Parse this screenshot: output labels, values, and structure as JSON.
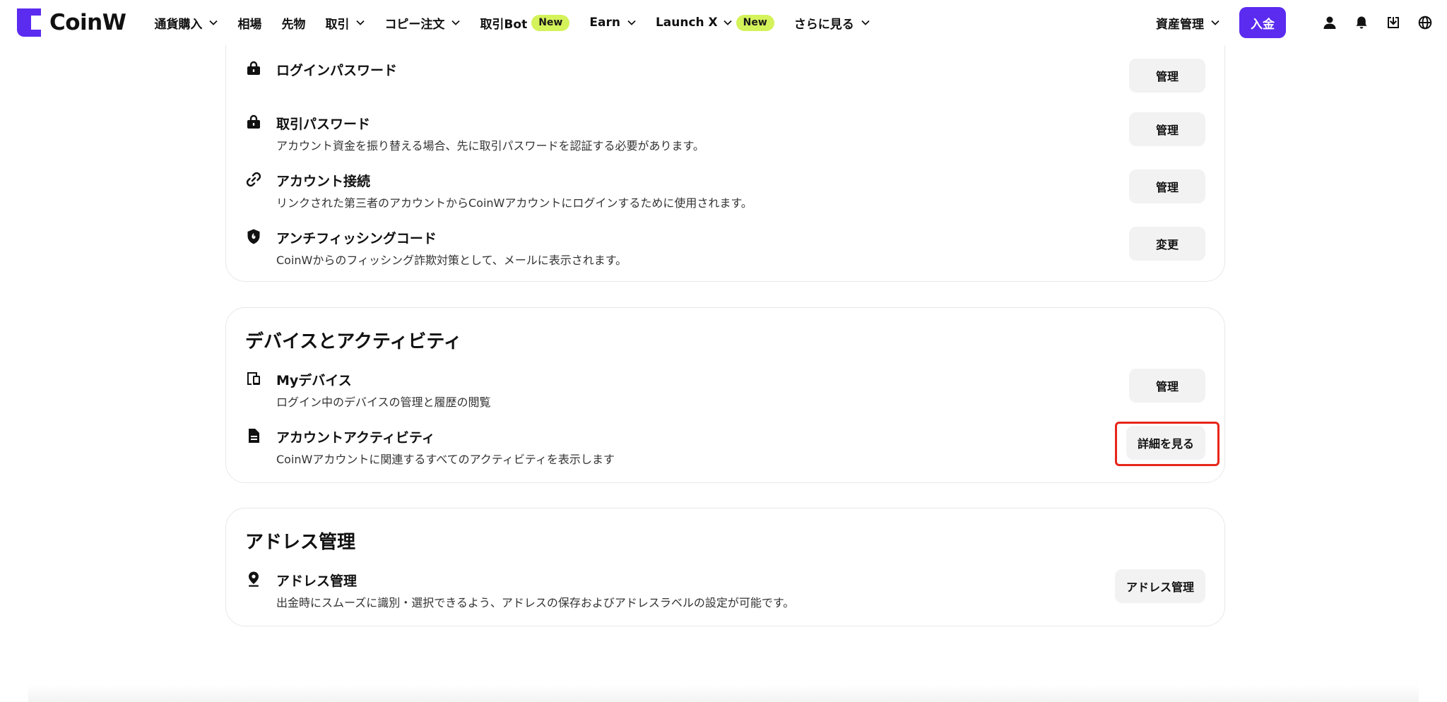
{
  "brand": {
    "name": "CoinW",
    "color": "#5b2bf0"
  },
  "nav": {
    "items": [
      {
        "label": "通貨購入",
        "has_dropdown": true
      },
      {
        "label": "相場",
        "has_dropdown": false
      },
      {
        "label": "先物",
        "has_dropdown": false
      },
      {
        "label": "取引",
        "has_dropdown": true
      },
      {
        "label": "コピー注文",
        "has_dropdown": true
      },
      {
        "label": "取引Bot",
        "has_dropdown": false,
        "badge": "New"
      },
      {
        "label": "Earn",
        "has_dropdown": true
      },
      {
        "label": "Launch X",
        "has_dropdown": true,
        "badge": "New"
      },
      {
        "label": "さらに見る",
        "has_dropdown": true
      }
    ]
  },
  "header_right": {
    "asset_label": "資産管理",
    "deposit_label": "入金",
    "icons": [
      "user-icon",
      "bell-icon",
      "download-icon",
      "globe-icon"
    ]
  },
  "security": {
    "rows": [
      {
        "icon": "lock-icon",
        "title": "ログインパスワード",
        "desc": "",
        "button": "管理"
      },
      {
        "icon": "lock-icon",
        "title": "取引パスワード",
        "desc": "アカウント資金を振り替える場合、先に取引パスワードを認証する必要があります。",
        "button": "管理"
      },
      {
        "icon": "link-icon",
        "title": "アカウント接続",
        "desc": "リンクされた第三者のアカウントからCoinWアカウントにログインするために使用されます。",
        "button": "管理"
      },
      {
        "icon": "shield-icon",
        "title": "アンチフィッシングコード",
        "desc": "CoinWからのフィッシング詐欺対策として、メールに表示されます。",
        "button": "変更"
      }
    ]
  },
  "devices": {
    "title": "デバイスとアクティビティ",
    "rows": [
      {
        "icon": "device-icon",
        "title": "Myデバイス",
        "desc": "ログイン中のデバイスの管理と履歴の閲覧",
        "button": "管理"
      },
      {
        "icon": "document-icon",
        "title": "アカウントアクティビティ",
        "desc": "CoinWアカウントに関連するすべてのアクティビティを表示します",
        "button": "詳細を見る"
      }
    ]
  },
  "address": {
    "title": "アドレス管理",
    "rows": [
      {
        "icon": "location-pin-icon",
        "title": "アドレス管理",
        "desc": "出金時にスムーズに識別・選択できるよう、アドレスの保存およびアドレスラベルの設定が可能です。",
        "button": "アドレス管理"
      }
    ]
  },
  "colors": {
    "accent": "#5b2bf0",
    "new_badge": "#d4f25a",
    "highlight": "#e8251a",
    "button_bg": "#f2f2f2"
  }
}
